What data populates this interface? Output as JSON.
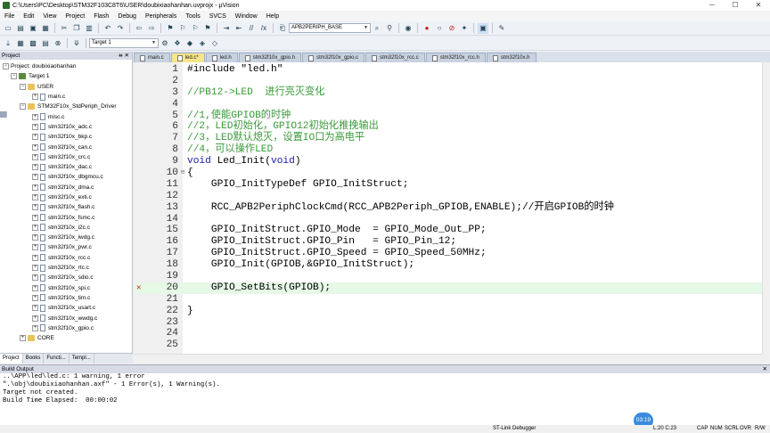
{
  "window": {
    "title": "C:\\Users\\PC\\Desktop\\STM32F103C8T6\\USER\\doubixiaohanhan.uvprojx - µVision",
    "minimize": "─",
    "maximize": "☐",
    "close": "✕"
  },
  "menu": [
    "File",
    "Edit",
    "View",
    "Project",
    "Flash",
    "Debug",
    "Peripherals",
    "Tools",
    "SVCS",
    "Window",
    "Help"
  ],
  "toolbar1": {
    "function_combo": "APB2PERIPH_BASE"
  },
  "toolbar2": {
    "target_combo": "Target 1"
  },
  "project_panel": {
    "title": "Project",
    "pin": "ᚑ ✕",
    "tree": [
      {
        "label": "Project: doubixiaohanhan",
        "level": 0,
        "kind": "proj",
        "expand": "−"
      },
      {
        "label": "Target 1",
        "level": 1,
        "kind": "target",
        "expand": "−"
      },
      {
        "label": "USER",
        "level": 2,
        "kind": "folder",
        "expand": "−"
      },
      {
        "label": "main.c",
        "level": 3,
        "kind": "file",
        "expand": "+"
      },
      {
        "label": "STM32F10x_StdPeriph_Driver",
        "level": 2,
        "kind": "folder",
        "expand": "−"
      },
      {
        "label": "misc.c",
        "level": 3,
        "kind": "file",
        "expand": "+"
      },
      {
        "label": "stm32f10x_adc.c",
        "level": 3,
        "kind": "file",
        "expand": "+"
      },
      {
        "label": "stm32f10x_bkp.c",
        "level": 3,
        "kind": "file",
        "expand": "+"
      },
      {
        "label": "stm32f10x_can.c",
        "level": 3,
        "kind": "file",
        "expand": "+"
      },
      {
        "label": "stm32f10x_crc.c",
        "level": 3,
        "kind": "file",
        "expand": "+"
      },
      {
        "label": "stm32f10x_dac.c",
        "level": 3,
        "kind": "file",
        "expand": "+"
      },
      {
        "label": "stm32f10x_dbgmcu.c",
        "level": 3,
        "kind": "file",
        "expand": "+"
      },
      {
        "label": "stm32f10x_dma.c",
        "level": 3,
        "kind": "file",
        "expand": "+"
      },
      {
        "label": "stm32f10x_exti.c",
        "level": 3,
        "kind": "file",
        "expand": "+"
      },
      {
        "label": "stm32f10x_flash.c",
        "level": 3,
        "kind": "file",
        "expand": "+"
      },
      {
        "label": "stm32f10x_fsmc.c",
        "level": 3,
        "kind": "file",
        "expand": "+"
      },
      {
        "label": "stm32f10x_i2c.c",
        "level": 3,
        "kind": "file",
        "expand": "+"
      },
      {
        "label": "stm32f10x_iwdg.c",
        "level": 3,
        "kind": "file",
        "expand": "+"
      },
      {
        "label": "stm32f10x_pwr.c",
        "level": 3,
        "kind": "file",
        "expand": "+"
      },
      {
        "label": "stm32f10x_rcc.c",
        "level": 3,
        "kind": "file",
        "expand": "+"
      },
      {
        "label": "stm32f10x_rtc.c",
        "level": 3,
        "kind": "file",
        "expand": "+"
      },
      {
        "label": "stm32f10x_sdio.c",
        "level": 3,
        "kind": "file",
        "expand": "+"
      },
      {
        "label": "stm32f10x_spi.c",
        "level": 3,
        "kind": "file",
        "expand": "+"
      },
      {
        "label": "stm32f10x_tim.c",
        "level": 3,
        "kind": "file",
        "expand": "+"
      },
      {
        "label": "stm32f10x_usart.c",
        "level": 3,
        "kind": "file",
        "expand": "+"
      },
      {
        "label": "stm32f10x_wwdg.c",
        "level": 3,
        "kind": "file",
        "expand": "+"
      },
      {
        "label": "stm32f10x_gpio.c",
        "level": 3,
        "kind": "file",
        "expand": "+"
      },
      {
        "label": "CORE",
        "level": 2,
        "kind": "folder",
        "expand": "+"
      }
    ],
    "tabs": [
      "Project",
      "Books",
      "Functi...",
      "Templ..."
    ]
  },
  "editor_tabs": [
    {
      "label": "main.c",
      "active": false
    },
    {
      "label": "led.c*",
      "active": true
    },
    {
      "label": "led.h",
      "active": false
    },
    {
      "label": "stm32f10x_gpio.h",
      "active": false
    },
    {
      "label": "stm32f10x_gpio.c",
      "active": false
    },
    {
      "label": "stm32f10x_rcc.c",
      "active": false
    },
    {
      "label": "stm32f10x_rcc.h",
      "active": false
    },
    {
      "label": "stm32f10x.h",
      "active": false
    }
  ],
  "code": [
    {
      "n": "1",
      "text": "#include \"led.h\"",
      "cls": ""
    },
    {
      "n": "2",
      "text": "",
      "cls": ""
    },
    {
      "n": "3",
      "text": "//PB12->LED  进行亮灭变化",
      "cls": "cmt"
    },
    {
      "n": "4",
      "text": "",
      "cls": ""
    },
    {
      "n": "5",
      "text": "//1,使能GPIOB的时钟",
      "cls": "cmt"
    },
    {
      "n": "6",
      "text": "//2，LED初始化，GPIO12初始化推挽输出",
      "cls": "cmt"
    },
    {
      "n": "7",
      "text": "//3，LED默认熄灭，设置IO口为高电平",
      "cls": "cmt"
    },
    {
      "n": "8",
      "text": "//4，可以操作LED",
      "cls": "cmt"
    },
    {
      "n": "9",
      "text": "void Led_Init(void)",
      "cls": ""
    },
    {
      "n": "10",
      "text": "{",
      "cls": "",
      "fold": "⊟"
    },
    {
      "n": "11",
      "text": "    GPIO_InitTypeDef GPIO_InitStruct;",
      "cls": ""
    },
    {
      "n": "12",
      "text": "",
      "cls": ""
    },
    {
      "n": "13",
      "text": "    RCC_APB2PeriphClockCmd(RCC_APB2Periph_GPIOB,ENABLE);//开启GPIOB的时钟",
      "cls": ""
    },
    {
      "n": "14",
      "text": "",
      "cls": ""
    },
    {
      "n": "15",
      "text": "    GPIO_InitStruct.GPIO_Mode  = GPIO_Mode_Out_PP;",
      "cls": ""
    },
    {
      "n": "16",
      "text": "    GPIO_InitStruct.GPIO_Pin   = GPIO_Pin_12;",
      "cls": ""
    },
    {
      "n": "17",
      "text": "    GPIO_InitStruct.GPIO_Speed = GPIO_Speed_50MHz;",
      "cls": ""
    },
    {
      "n": "18",
      "text": "    GPIO_Init(GPIOB,&GPIO_InitStruct);",
      "cls": ""
    },
    {
      "n": "19",
      "text": "",
      "cls": ""
    },
    {
      "n": "20",
      "text": "    GPIO_SetBits(GPIOB);",
      "cls": "hl",
      "mark": "✕"
    },
    {
      "n": "21",
      "text": "",
      "cls": ""
    },
    {
      "n": "22",
      "text": "}",
      "cls": ""
    },
    {
      "n": "23",
      "text": "",
      "cls": ""
    },
    {
      "n": "24",
      "text": "",
      "cls": ""
    },
    {
      "n": "25",
      "text": "",
      "cls": ""
    }
  ],
  "build_output": {
    "title": "Build Output",
    "lines": [
      "..\\APP\\led\\led.c: 1 warning, 1 error",
      "\".\\obj\\doubixiaohanhan.axf\" - 1 Error(s), 1 Warning(s).",
      "Target not created.",
      "Build Time Elapsed:  00:00:02"
    ]
  },
  "timer_badge": "03:19",
  "status": {
    "debugger": "ST-Link Debugger",
    "position": "L:20 C:23",
    "caps": "CAP",
    "num": "NUM",
    "scrl": "SCRL",
    "ovr": "OVR",
    "rw": "R/W"
  },
  "colors": {
    "comment": "#3a9a3a",
    "keyword": "#1a1ab0",
    "active_tab": "#f7e58a",
    "current_line": "#e6f8e6",
    "error_mark": "#d02020"
  }
}
